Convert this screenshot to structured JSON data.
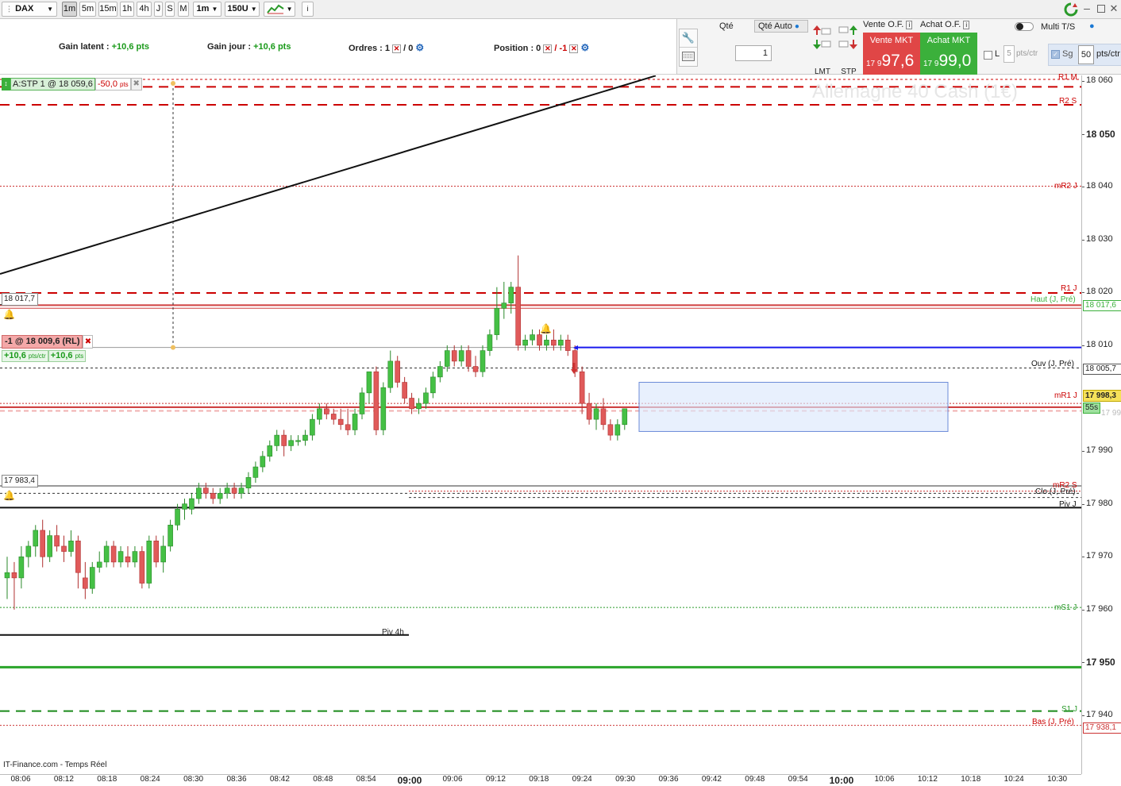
{
  "toolbar": {
    "symbol": "DAX",
    "timeframes": [
      "1m",
      "5m",
      "15m",
      "1h",
      "4h",
      "J",
      "S",
      "M"
    ],
    "active_timeframe": "1m",
    "period": "1m",
    "bars": "150U",
    "info_icon": "info-icon"
  },
  "infobar": {
    "gain_latent_label": "Gain latent :",
    "gain_latent_value": "+10,6 pts",
    "gain_jour_label": "Gain jour :",
    "gain_jour_value": "+10,6 pts",
    "ordres_label": "Ordres :",
    "ordres_value_a": "1",
    "ordres_value_b": "/ 0",
    "position_label": "Position :",
    "position_value_a": "0",
    "position_value_b": "/ -1"
  },
  "order_panel": {
    "qte_label": "Qté",
    "qte_auto_label": "Qté Auto",
    "qty_value": "1",
    "lmt_label": "LMT",
    "stp_label": "STP",
    "vente_of_label": "Vente O.F.",
    "achat_of_label": "Achat O.F.",
    "vente_mkt_label": "Vente MKT",
    "achat_mkt_label": "Achat MKT",
    "vente_price_small": "17 9",
    "vente_price_big": "97,6",
    "achat_price_small": "17 9",
    "achat_price_big": "99,0",
    "multi_ts_label": "Multi T/S",
    "l_label": "L",
    "l_value": "5",
    "pts_ctr_label": "pts/ctr",
    "sg_label": "Sg",
    "sg_value": "50",
    "sg_unit": "pts/ctr",
    "colors": {
      "sell": "#e04646",
      "buy": "#3bb03b"
    }
  },
  "chart": {
    "watermark": "Allemagne 40 Cash (1€)",
    "footer": "IT-Finance.com - Temps Réel",
    "stop_order_tag": "A:STP 1 @ 18 059,6",
    "stop_order_pts": "-50,0",
    "stop_order_pts_unit": "pts",
    "position_tag": "-1 @ 18 009,6 (RL)",
    "position_gain_a": "+10,6",
    "position_gain_a_unit": "pts/ctr",
    "position_gain_b": "+10,6",
    "position_gain_b_unit": "pts",
    "alert_label_1": "18 017,7",
    "alert_label_2": "17 983,4",
    "piv4h_label": "Piv 4h",
    "countdown": "55s",
    "level_labels": {
      "r1m": "R1 M",
      "r2s": "R2 S",
      "mr2j": "mR2 J",
      "r1j": "R1 J",
      "haut": "Haut (J, Pré)",
      "ouv": "Ouv (J, Pré)",
      "mr1j": "mR1 J",
      "mr2s": "mR2 S",
      "clo": "Clo (J, Pré)",
      "pivj": "Piv J",
      "ms1j": "mS1 J",
      "s1j": "S1 J",
      "bas": "Bas (J, Pré)"
    },
    "yaxis_ticks": [
      "18 060",
      "18 050",
      "18 040",
      "18 030",
      "18 020",
      "18 010",
      "17 990",
      "17 980",
      "17 970",
      "17 960",
      "17 950",
      "17 940"
    ],
    "yaxis_tags": {
      "haut": "18 017,6",
      "ouv": "18 005,7",
      "last": "17 998,3",
      "last_ghost": "17 998,3",
      "bas": "17 938,1"
    },
    "xaxis_ticks": [
      "08:06",
      "08:12",
      "08:18",
      "08:24",
      "08:30",
      "08:36",
      "08:42",
      "08:48",
      "08:54",
      "09:00",
      "09:06",
      "09:12",
      "09:18",
      "09:24",
      "09:30",
      "09:36",
      "09:42",
      "09:48",
      "09:54",
      "10:00",
      "10:06",
      "10:12",
      "10:18",
      "10:24",
      "10:30"
    ]
  },
  "chart_data": {
    "type": "candlestick",
    "title": "Allemagne 40 Cash (1€)",
    "ylim": [
      17936,
      18061
    ],
    "candles": [
      {
        "o": 17966,
        "h": 17970,
        "l": 17962,
        "c": 17967
      },
      {
        "o": 17967,
        "h": 17969,
        "l": 17960,
        "c": 17966
      },
      {
        "o": 17966,
        "h": 17972,
        "l": 17964,
        "c": 17970
      },
      {
        "o": 17970,
        "h": 17973,
        "l": 17968,
        "c": 17972
      },
      {
        "o": 17972,
        "h": 17976,
        "l": 17970,
        "c": 17975
      },
      {
        "o": 17975,
        "h": 17977,
        "l": 17968,
        "c": 17970
      },
      {
        "o": 17970,
        "h": 17975,
        "l": 17969,
        "c": 17974
      },
      {
        "o": 17974,
        "h": 17976,
        "l": 17971,
        "c": 17972
      },
      {
        "o": 17972,
        "h": 17974,
        "l": 17969,
        "c": 17971
      },
      {
        "o": 17971,
        "h": 17975,
        "l": 17970,
        "c": 17973
      },
      {
        "o": 17973,
        "h": 17974,
        "l": 17964,
        "c": 17967
      },
      {
        "o": 17966,
        "h": 17969,
        "l": 17962,
        "c": 17964
      },
      {
        "o": 17964,
        "h": 17969,
        "l": 17963,
        "c": 17968
      },
      {
        "o": 17968,
        "h": 17971,
        "l": 17967,
        "c": 17969
      },
      {
        "o": 17969,
        "h": 17973,
        "l": 17968,
        "c": 17972
      },
      {
        "o": 17972,
        "h": 17973,
        "l": 17968,
        "c": 17969
      },
      {
        "o": 17969,
        "h": 17972,
        "l": 17968,
        "c": 17971
      },
      {
        "o": 17970,
        "h": 17972,
        "l": 17968,
        "c": 17969
      },
      {
        "o": 17969,
        "h": 17972,
        "l": 17968,
        "c": 17971
      },
      {
        "o": 17971,
        "h": 17972,
        "l": 17964,
        "c": 17965
      },
      {
        "o": 17965,
        "h": 17974,
        "l": 17964,
        "c": 17973
      },
      {
        "o": 17973,
        "h": 17974,
        "l": 17968,
        "c": 17969
      },
      {
        "o": 17969,
        "h": 17974,
        "l": 17967,
        "c": 17972
      },
      {
        "o": 17972,
        "h": 17977,
        "l": 17971,
        "c": 17976
      },
      {
        "o": 17976,
        "h": 17980,
        "l": 17975,
        "c": 17979
      },
      {
        "o": 17979,
        "h": 17981,
        "l": 17977,
        "c": 17980
      },
      {
        "o": 17979,
        "h": 17982,
        "l": 17978,
        "c": 17981
      },
      {
        "o": 17981,
        "h": 17984,
        "l": 17980,
        "c": 17983
      },
      {
        "o": 17983,
        "h": 17984,
        "l": 17981,
        "c": 17982
      },
      {
        "o": 17982,
        "h": 17983,
        "l": 17980,
        "c": 17981
      },
      {
        "o": 17981,
        "h": 17983,
        "l": 17980,
        "c": 17982
      },
      {
        "o": 17982,
        "h": 17984,
        "l": 17981,
        "c": 17983
      },
      {
        "o": 17983,
        "h": 17984,
        "l": 17981,
        "c": 17982
      },
      {
        "o": 17982,
        "h": 17984,
        "l": 17981,
        "c": 17983
      },
      {
        "o": 17983,
        "h": 17986,
        "l": 17982,
        "c": 17985
      },
      {
        "o": 17985,
        "h": 17988,
        "l": 17984,
        "c": 17987
      },
      {
        "o": 17987,
        "h": 17990,
        "l": 17986,
        "c": 17989
      },
      {
        "o": 17989,
        "h": 17992,
        "l": 17988,
        "c": 17991
      },
      {
        "o": 17991,
        "h": 17994,
        "l": 17990,
        "c": 17993
      },
      {
        "o": 17993,
        "h": 17994,
        "l": 17989,
        "c": 17991
      },
      {
        "o": 17991,
        "h": 17993,
        "l": 17990,
        "c": 17992
      },
      {
        "o": 17992,
        "h": 17993,
        "l": 17991,
        "c": 17992
      },
      {
        "o": 17992,
        "h": 17994,
        "l": 17991,
        "c": 17993
      },
      {
        "o": 17993,
        "h": 17997,
        "l": 17992,
        "c": 17996
      },
      {
        "o": 17996,
        "h": 17999,
        "l": 17995,
        "c": 17998
      },
      {
        "o": 17998,
        "h": 17999,
        "l": 17996,
        "c": 17997
      },
      {
        "o": 17997,
        "h": 17998,
        "l": 17995,
        "c": 17996
      },
      {
        "o": 17996,
        "h": 17998,
        "l": 17994,
        "c": 17995
      },
      {
        "o": 17995,
        "h": 17998,
        "l": 17993,
        "c": 17994
      },
      {
        "o": 17994,
        "h": 17998,
        "l": 17993,
        "c": 17997
      },
      {
        "o": 17997,
        "h": 18002,
        "l": 17996,
        "c": 18001
      },
      {
        "o": 18001,
        "h": 18005,
        "l": 17999,
        "c": 18005
      },
      {
        "o": 18005,
        "h": 18006,
        "l": 17993,
        "c": 17994
      },
      {
        "o": 17994,
        "h": 18003,
        "l": 17993,
        "c": 18002
      },
      {
        "o": 18002,
        "h": 18009,
        "l": 18001,
        "c": 18007
      },
      {
        "o": 18007,
        "h": 18008,
        "l": 18002,
        "c": 18003
      },
      {
        "o": 18003,
        "h": 18004,
        "l": 17999,
        "c": 18000
      },
      {
        "o": 18000,
        "h": 18001,
        "l": 17997,
        "c": 17998
      },
      {
        "o": 17998,
        "h": 18000,
        "l": 17997,
        "c": 17999
      },
      {
        "o": 17999,
        "h": 18002,
        "l": 17998,
        "c": 18001
      },
      {
        "o": 18001,
        "h": 18005,
        "l": 18000,
        "c": 18004
      },
      {
        "o": 18004,
        "h": 18007,
        "l": 18003,
        "c": 18006
      },
      {
        "o": 18006,
        "h": 18010,
        "l": 18005,
        "c": 18009
      },
      {
        "o": 18009,
        "h": 18010,
        "l": 18006,
        "c": 18007
      },
      {
        "o": 18007,
        "h": 18010,
        "l": 18006,
        "c": 18009
      },
      {
        "o": 18009,
        "h": 18010,
        "l": 18005,
        "c": 18006
      },
      {
        "o": 18006,
        "h": 18008,
        "l": 18004,
        "c": 18005
      },
      {
        "o": 18005,
        "h": 18010,
        "l": 18004,
        "c": 18009
      },
      {
        "o": 18009,
        "h": 18013,
        "l": 18008,
        "c": 18012
      },
      {
        "o": 18012,
        "h": 18021,
        "l": 18011,
        "c": 18017
      },
      {
        "o": 18017,
        "h": 18022,
        "l": 18015,
        "c": 18018
      },
      {
        "o": 18018,
        "h": 18022,
        "l": 18016,
        "c": 18021
      },
      {
        "o": 18021,
        "h": 18027,
        "l": 18009,
        "c": 18010
      },
      {
        "o": 18010,
        "h": 18012,
        "l": 18009,
        "c": 18011
      },
      {
        "o": 18011,
        "h": 18013,
        "l": 18010,
        "c": 18012
      },
      {
        "o": 18012,
        "h": 18013,
        "l": 18009,
        "c": 18010
      },
      {
        "o": 18010,
        "h": 18012,
        "l": 18009,
        "c": 18011
      },
      {
        "o": 18011,
        "h": 18013,
        "l": 18009,
        "c": 18010
      },
      {
        "o": 18010,
        "h": 18012,
        "l": 18009,
        "c": 18011
      },
      {
        "o": 18011,
        "h": 18012,
        "l": 18008,
        "c": 18009
      },
      {
        "o": 18009,
        "h": 18010,
        "l": 18004,
        "c": 18005
      },
      {
        "o": 18005,
        "h": 18006,
        "l": 17997,
        "c": 17999
      },
      {
        "o": 17999,
        "h": 18001,
        "l": 17995,
        "c": 17996
      },
      {
        "o": 17996,
        "h": 17999,
        "l": 17994,
        "c": 17998
      },
      {
        "o": 17998,
        "h": 18000,
        "l": 17994,
        "c": 17995
      },
      {
        "o": 17995,
        "h": 17996,
        "l": 17992,
        "c": 17993
      },
      {
        "o": 17993,
        "h": 17996,
        "l": 17992,
        "c": 17995
      },
      {
        "o": 17995,
        "h": 17998,
        "l": 17994,
        "c": 17998
      }
    ],
    "xlabel": "",
    "ylabel": ""
  }
}
